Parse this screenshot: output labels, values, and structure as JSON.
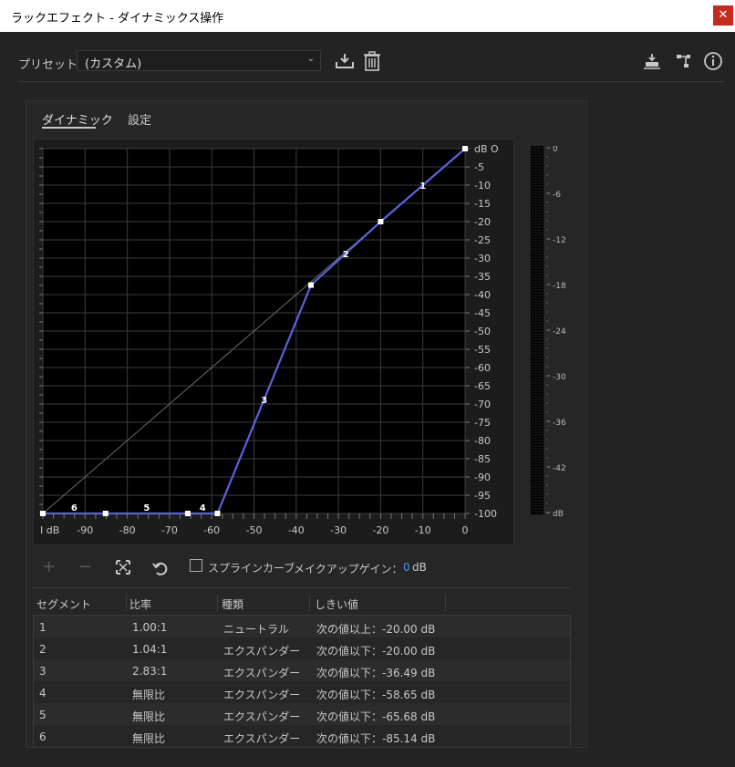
{
  "window": {
    "title": "ラックエフェクト - ダイナミックス操作",
    "close": "✕"
  },
  "preset": {
    "label": "プリセット：",
    "value": "(カスタム)"
  },
  "tabs": [
    {
      "label": "ダイナミック",
      "active": true
    },
    {
      "label": "設定",
      "active": false
    }
  ],
  "graph": {
    "right_labels": [
      "dB O",
      "-5",
      "-10",
      "-15",
      "-20",
      "-25",
      "-30",
      "-35",
      "-40",
      "-45",
      "-50",
      "-55",
      "-60",
      "-65",
      "-70",
      "-75",
      "-80",
      "-85",
      "-90",
      "-95",
      "-100"
    ],
    "bottom_labels": [
      "I dB",
      "-90",
      "-80",
      "-70",
      "-60",
      "-50",
      "-40",
      "-30",
      "-20",
      "-10",
      "0"
    ],
    "segment_labels": [
      "1",
      "2",
      "3",
      "4",
      "5",
      "6"
    ]
  },
  "chart_data": {
    "type": "line",
    "xlim": [
      -100,
      0
    ],
    "ylim": [
      -100,
      0
    ],
    "series": [
      {
        "points": [
          [
            -100,
            -100
          ],
          [
            -85.14,
            -100
          ],
          [
            -65.68,
            -100
          ],
          [
            -58.65,
            -100
          ],
          [
            -36.49,
            -37.4
          ],
          [
            -20,
            -20
          ],
          [
            0,
            0
          ]
        ]
      }
    ],
    "reference_line": [
      [
        -100,
        -100
      ],
      [
        0,
        0
      ]
    ]
  },
  "meter": {
    "labels": [
      "0",
      "-6",
      "-12",
      "-18",
      "-24",
      "-30",
      "-36",
      "-42",
      "dB"
    ]
  },
  "controls": {
    "add": "+",
    "remove": "−",
    "spline_label": "スプラインカーブ",
    "spline_checked": false,
    "makeup_label": "メイクアップゲイン：",
    "makeup_value": "0",
    "makeup_unit": "dB"
  },
  "table": {
    "headers": [
      "セグメント",
      "比率",
      "種類",
      "しきい値"
    ],
    "rows": [
      {
        "seg": "1",
        "ratio": "1.00:1",
        "type": "ニュートラル",
        "threshold": "次の値以上：-20.00 dB"
      },
      {
        "seg": "2",
        "ratio": "1.04:1",
        "type": "エクスパンダー",
        "threshold": "次の値以下：-20.00 dB"
      },
      {
        "seg": "3",
        "ratio": "2.83:1",
        "type": "エクスパンダー",
        "threshold": "次の値以下：-36.49 dB"
      },
      {
        "seg": "4",
        "ratio": "無限比",
        "type": "エクスパンダー",
        "threshold": "次の値以下：-58.65 dB"
      },
      {
        "seg": "5",
        "ratio": "無限比",
        "type": "エクスパンダー",
        "threshold": "次の値以下：-65.68 dB"
      },
      {
        "seg": "6",
        "ratio": "無限比",
        "type": "エクスパンダー",
        "threshold": "次の値以下：-85.14 dB"
      }
    ]
  },
  "colors": {
    "curve": "#5b63d9",
    "accent": "#4a90e2",
    "close_bg": "#c42b1c"
  }
}
